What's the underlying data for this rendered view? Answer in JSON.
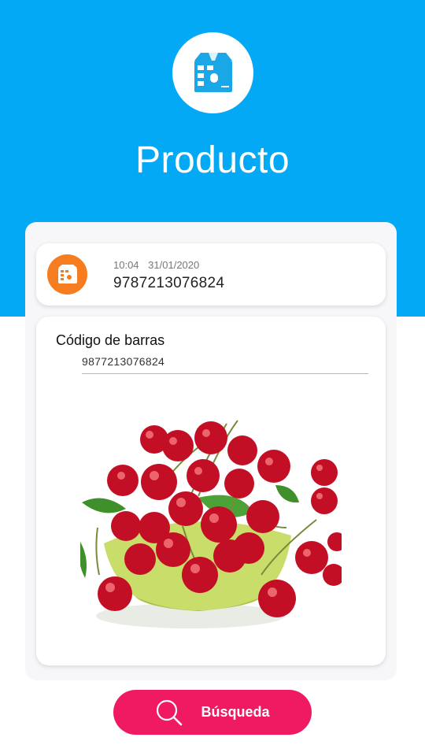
{
  "header": {
    "title": "Producto",
    "background_color": "#03a9f4",
    "logo_icon": "barcode-scanner-icon"
  },
  "history_item": {
    "icon": "barcode-scanner-icon",
    "icon_color": "#f57c1f",
    "time": "10:04",
    "date": "31/01/2020",
    "code": "9787213076824"
  },
  "product": {
    "barcode_label": "Código de barras",
    "barcode_value": "9877213076824",
    "image": "cherries-bowl-photo"
  },
  "search_button": {
    "label": "Búsqueda",
    "icon": "search-icon",
    "color": "#ef1a62"
  }
}
